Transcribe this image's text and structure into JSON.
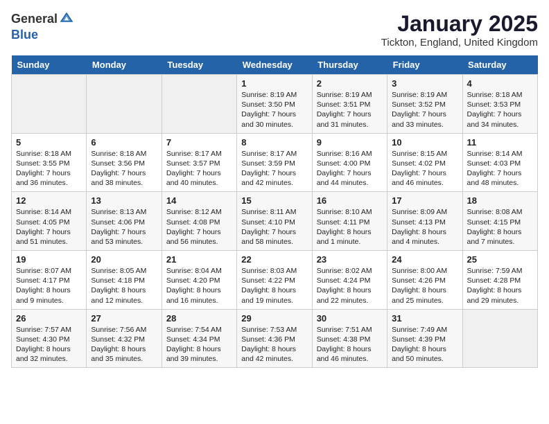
{
  "header": {
    "logo_line1": "General",
    "logo_line2": "Blue",
    "month": "January 2025",
    "location": "Tickton, England, United Kingdom"
  },
  "weekdays": [
    "Sunday",
    "Monday",
    "Tuesday",
    "Wednesday",
    "Thursday",
    "Friday",
    "Saturday"
  ],
  "weeks": [
    [
      {
        "day": "",
        "info": ""
      },
      {
        "day": "",
        "info": ""
      },
      {
        "day": "",
        "info": ""
      },
      {
        "day": "1",
        "info": "Sunrise: 8:19 AM\nSunset: 3:50 PM\nDaylight: 7 hours and 30 minutes."
      },
      {
        "day": "2",
        "info": "Sunrise: 8:19 AM\nSunset: 3:51 PM\nDaylight: 7 hours and 31 minutes."
      },
      {
        "day": "3",
        "info": "Sunrise: 8:19 AM\nSunset: 3:52 PM\nDaylight: 7 hours and 33 minutes."
      },
      {
        "day": "4",
        "info": "Sunrise: 8:18 AM\nSunset: 3:53 PM\nDaylight: 7 hours and 34 minutes."
      }
    ],
    [
      {
        "day": "5",
        "info": "Sunrise: 8:18 AM\nSunset: 3:55 PM\nDaylight: 7 hours and 36 minutes."
      },
      {
        "day": "6",
        "info": "Sunrise: 8:18 AM\nSunset: 3:56 PM\nDaylight: 7 hours and 38 minutes."
      },
      {
        "day": "7",
        "info": "Sunrise: 8:17 AM\nSunset: 3:57 PM\nDaylight: 7 hours and 40 minutes."
      },
      {
        "day": "8",
        "info": "Sunrise: 8:17 AM\nSunset: 3:59 PM\nDaylight: 7 hours and 42 minutes."
      },
      {
        "day": "9",
        "info": "Sunrise: 8:16 AM\nSunset: 4:00 PM\nDaylight: 7 hours and 44 minutes."
      },
      {
        "day": "10",
        "info": "Sunrise: 8:15 AM\nSunset: 4:02 PM\nDaylight: 7 hours and 46 minutes."
      },
      {
        "day": "11",
        "info": "Sunrise: 8:14 AM\nSunset: 4:03 PM\nDaylight: 7 hours and 48 minutes."
      }
    ],
    [
      {
        "day": "12",
        "info": "Sunrise: 8:14 AM\nSunset: 4:05 PM\nDaylight: 7 hours and 51 minutes."
      },
      {
        "day": "13",
        "info": "Sunrise: 8:13 AM\nSunset: 4:06 PM\nDaylight: 7 hours and 53 minutes."
      },
      {
        "day": "14",
        "info": "Sunrise: 8:12 AM\nSunset: 4:08 PM\nDaylight: 7 hours and 56 minutes."
      },
      {
        "day": "15",
        "info": "Sunrise: 8:11 AM\nSunset: 4:10 PM\nDaylight: 7 hours and 58 minutes."
      },
      {
        "day": "16",
        "info": "Sunrise: 8:10 AM\nSunset: 4:11 PM\nDaylight: 8 hours and 1 minute."
      },
      {
        "day": "17",
        "info": "Sunrise: 8:09 AM\nSunset: 4:13 PM\nDaylight: 8 hours and 4 minutes."
      },
      {
        "day": "18",
        "info": "Sunrise: 8:08 AM\nSunset: 4:15 PM\nDaylight: 8 hours and 7 minutes."
      }
    ],
    [
      {
        "day": "19",
        "info": "Sunrise: 8:07 AM\nSunset: 4:17 PM\nDaylight: 8 hours and 9 minutes."
      },
      {
        "day": "20",
        "info": "Sunrise: 8:05 AM\nSunset: 4:18 PM\nDaylight: 8 hours and 12 minutes."
      },
      {
        "day": "21",
        "info": "Sunrise: 8:04 AM\nSunset: 4:20 PM\nDaylight: 8 hours and 16 minutes."
      },
      {
        "day": "22",
        "info": "Sunrise: 8:03 AM\nSunset: 4:22 PM\nDaylight: 8 hours and 19 minutes."
      },
      {
        "day": "23",
        "info": "Sunrise: 8:02 AM\nSunset: 4:24 PM\nDaylight: 8 hours and 22 minutes."
      },
      {
        "day": "24",
        "info": "Sunrise: 8:00 AM\nSunset: 4:26 PM\nDaylight: 8 hours and 25 minutes."
      },
      {
        "day": "25",
        "info": "Sunrise: 7:59 AM\nSunset: 4:28 PM\nDaylight: 8 hours and 29 minutes."
      }
    ],
    [
      {
        "day": "26",
        "info": "Sunrise: 7:57 AM\nSunset: 4:30 PM\nDaylight: 8 hours and 32 minutes."
      },
      {
        "day": "27",
        "info": "Sunrise: 7:56 AM\nSunset: 4:32 PM\nDaylight: 8 hours and 35 minutes."
      },
      {
        "day": "28",
        "info": "Sunrise: 7:54 AM\nSunset: 4:34 PM\nDaylight: 8 hours and 39 minutes."
      },
      {
        "day": "29",
        "info": "Sunrise: 7:53 AM\nSunset: 4:36 PM\nDaylight: 8 hours and 42 minutes."
      },
      {
        "day": "30",
        "info": "Sunrise: 7:51 AM\nSunset: 4:38 PM\nDaylight: 8 hours and 46 minutes."
      },
      {
        "day": "31",
        "info": "Sunrise: 7:49 AM\nSunset: 4:39 PM\nDaylight: 8 hours and 50 minutes."
      },
      {
        "day": "",
        "info": ""
      }
    ]
  ]
}
